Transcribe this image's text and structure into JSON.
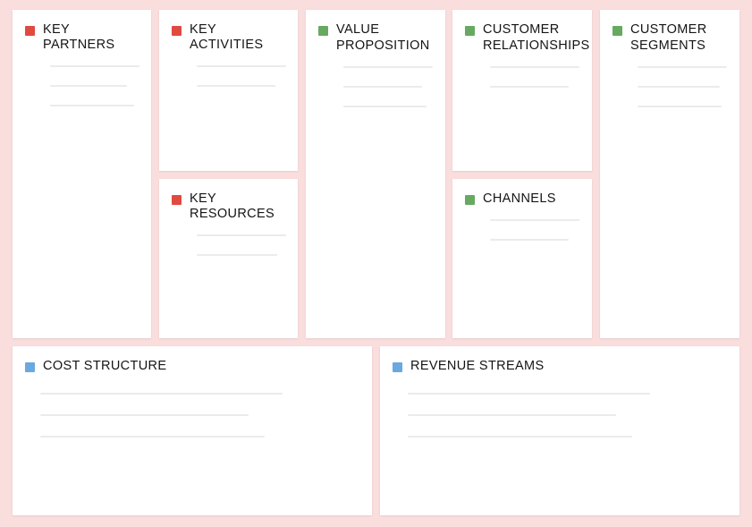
{
  "canvas": {
    "type": "business-model-canvas",
    "background_color": "#fadddd",
    "card_color": "#ffffff",
    "line_color": "#ebebeb",
    "title_color": "#141414"
  },
  "bullet_colors": {
    "red": "#e04a40",
    "green": "#67a961",
    "blue": "#6aa8e0"
  },
  "blocks": [
    {
      "id": "key-partners",
      "title": "KEY PARTNERS",
      "bullet": "red",
      "bullet_icon": "square-bullet-icon",
      "lines": 3
    },
    {
      "id": "key-activities",
      "title": "KEY ACTIVITIES",
      "bullet": "red",
      "bullet_icon": "square-bullet-icon",
      "lines": 2
    },
    {
      "id": "key-resources",
      "title": "KEY RESOURCES",
      "bullet": "red",
      "bullet_icon": "square-bullet-icon",
      "lines": 2
    },
    {
      "id": "value-proposition",
      "title": "VALUE\nPROPOSITION",
      "bullet": "green",
      "bullet_icon": "square-bullet-icon",
      "lines": 3
    },
    {
      "id": "customer-relationships",
      "title": "CUSTOMER\nRELATIONSHIPS",
      "bullet": "green",
      "bullet_icon": "square-bullet-icon",
      "lines": 2
    },
    {
      "id": "channels",
      "title": "CHANNELS",
      "bullet": "green",
      "bullet_icon": "square-bullet-icon",
      "lines": 2
    },
    {
      "id": "customer-segments",
      "title": "CUSTOMER\nSEGMENTS",
      "bullet": "green",
      "bullet_icon": "square-bullet-icon",
      "lines": 3
    },
    {
      "id": "cost-structure",
      "title": "COST STRUCTURE",
      "bullet": "blue",
      "bullet_icon": "square-bullet-icon",
      "lines": 3
    },
    {
      "id": "revenue-streams",
      "title": "REVENUE STREAMS",
      "bullet": "blue",
      "bullet_icon": "square-bullet-icon",
      "lines": 3
    }
  ]
}
